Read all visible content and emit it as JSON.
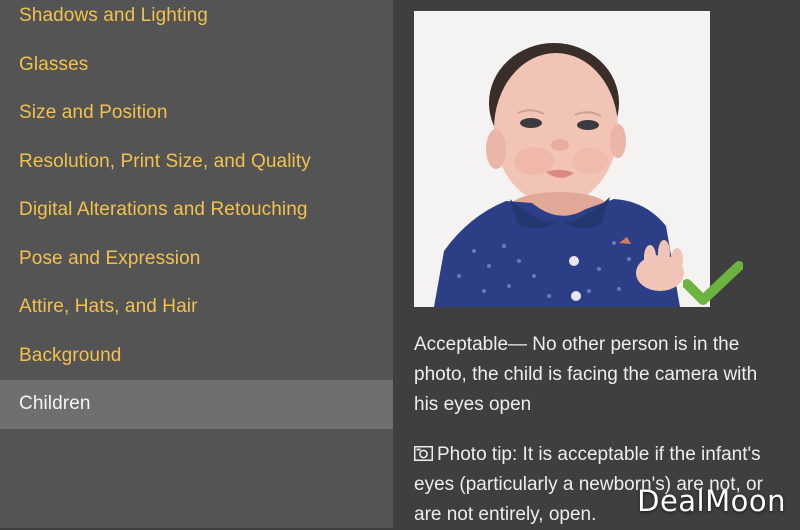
{
  "sidebar": {
    "items": [
      {
        "label": "Shadows and Lighting"
      },
      {
        "label": "Glasses"
      },
      {
        "label": "Size and Position"
      },
      {
        "label": "Resolution, Print Size, and Quality"
      },
      {
        "label": "Digital Alterations and Retouching"
      },
      {
        "label": "Pose and Expression"
      },
      {
        "label": "Attire, Hats, and Hair"
      },
      {
        "label": "Background"
      },
      {
        "label": "Children"
      }
    ],
    "active_index": 8
  },
  "main": {
    "photo_icon": "baby-photo",
    "check_icon": "checkmark-icon",
    "caption": "Acceptable— No other person is in the photo, the child is facing the camera with his eyes open",
    "tip_icon": "camera-icon",
    "tip": "Photo tip: It is acceptable if the infant's eyes (particularly a newborn's) are not, or are not entirely, open."
  },
  "watermark": "DealMoon",
  "colors": {
    "background": "#3f3f3f",
    "sidebar": "#545454",
    "active_item": "#6f6f6f",
    "link": "#f2c14e",
    "check": "#6cb33f"
  }
}
